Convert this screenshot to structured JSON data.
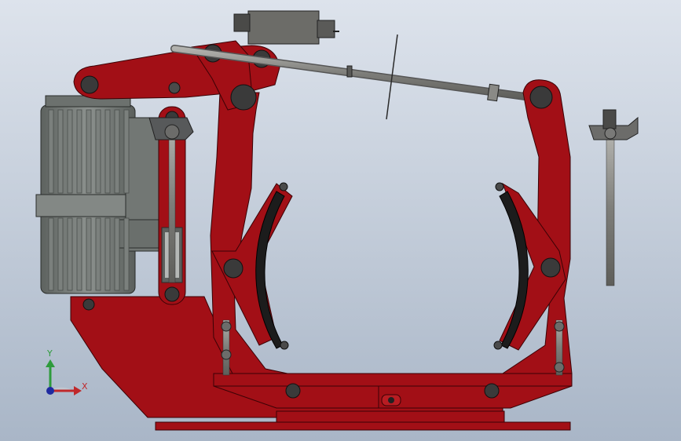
{
  "viewport": {
    "background_top": "#dde3ec",
    "background_bottom": "#a9b6c7"
  },
  "colors": {
    "brake_red": "#a20f16",
    "brake_red_dark": "#6b070c",
    "brake_red_light": "#c2262d",
    "motor_gray": "#7b807d",
    "motor_gray_dark": "#4a4e4c",
    "rod_gray": "#8a8a86",
    "lining_black": "#1c1c1c",
    "triad_x": "#c0282b",
    "triad_y": "#2e9b3c",
    "triad_z": "#1f2aa0"
  },
  "triad": {
    "x_label": "X",
    "y_label": "Y"
  }
}
